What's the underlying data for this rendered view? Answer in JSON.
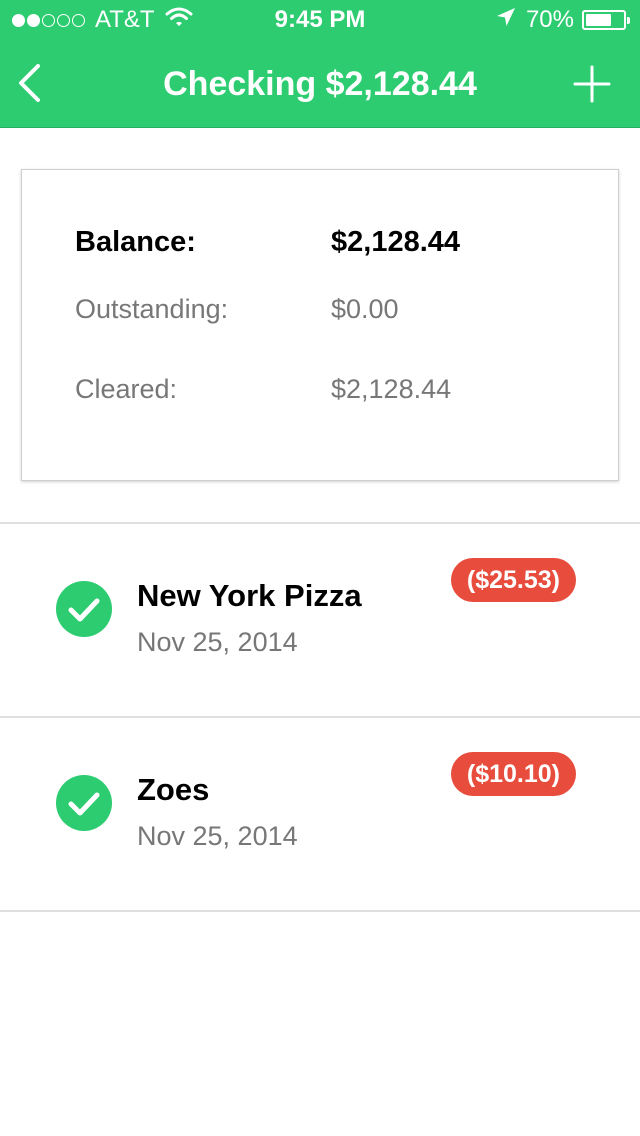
{
  "status_bar": {
    "signal_dots_filled": 2,
    "signal_dots_total": 5,
    "carrier": "AT&T",
    "time": "9:45 PM",
    "battery": "70%",
    "battery_level": 0.7,
    "icons": [
      "wifi-icon",
      "location-arrow-icon",
      "battery-icon"
    ]
  },
  "nav": {
    "title": "Checking $2,128.44",
    "back_icon": "chevron-left-icon",
    "add_icon": "plus-icon"
  },
  "summary": {
    "balance_label": "Balance:",
    "balance_value": "$2,128.44",
    "outstanding_label": "Outstanding:",
    "outstanding_value": "$0.00",
    "cleared_label": "Cleared:",
    "cleared_value": "$2,128.44"
  },
  "transactions": [
    {
      "name": "New York Pizza",
      "date": "Nov 25, 2014",
      "amount": "($25.53)",
      "status_icon": "checkmark-circle-icon"
    },
    {
      "name": "Zoes",
      "date": "Nov 25, 2014",
      "amount": "($10.10)",
      "status_icon": "checkmark-circle-icon"
    }
  ],
  "colors": {
    "brand_green": "#2ecc71",
    "debit_red": "#e74c3c",
    "muted_text": "#777777"
  }
}
